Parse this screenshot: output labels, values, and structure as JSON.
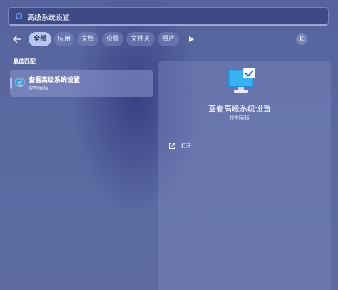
{
  "search": {
    "value": "高级系统设置"
  },
  "filters": {
    "items": [
      "全部",
      "应用",
      "文档",
      "设置",
      "文件夹",
      "照片"
    ],
    "active_index": 0
  },
  "account": {
    "initial": "K"
  },
  "more_label": "···",
  "best_match": {
    "heading": "最佳匹配",
    "name": "查看高级系统设置",
    "subtitle": "控制面板"
  },
  "detail": {
    "title": "查看高级系统设置",
    "subtitle": "控制面板",
    "actions": [
      {
        "label": "打开",
        "icon": "open-external-icon"
      }
    ]
  },
  "icons": {
    "search": "search-icon",
    "back": "back-arrow-icon",
    "play": "play-icon",
    "app": "system-settings-monitor-icon"
  },
  "colors": {
    "background": "#5a6aa1",
    "active_chip": "#b9c8f2",
    "accent_check": "#1a6fd6"
  }
}
